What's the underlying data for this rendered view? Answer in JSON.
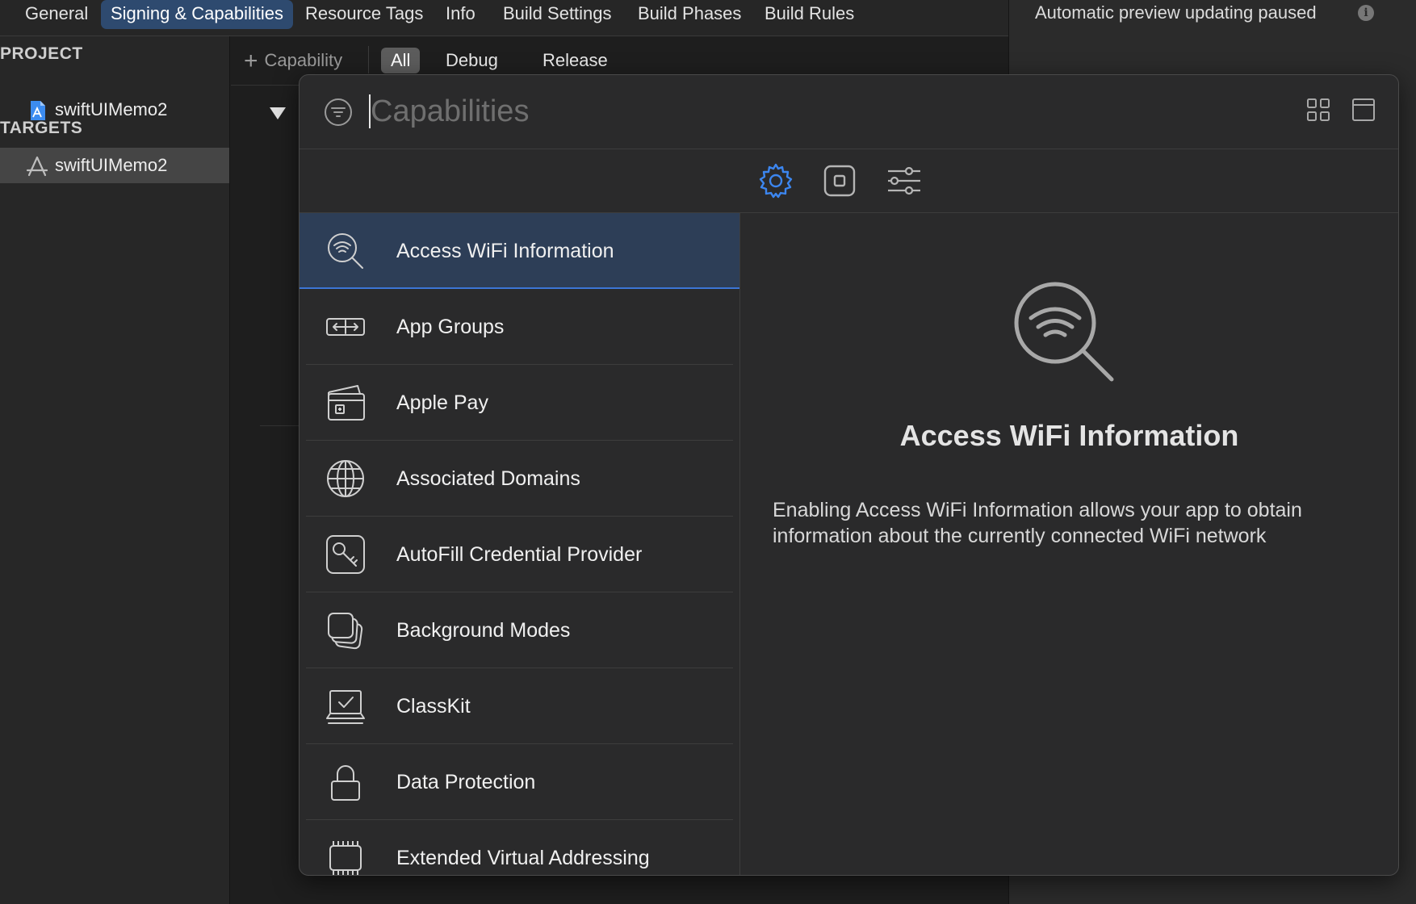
{
  "tabs": [
    {
      "label": "General",
      "active": false
    },
    {
      "label": "Signing & Capabilities",
      "active": true
    },
    {
      "label": "Resource Tags",
      "active": false
    },
    {
      "label": "Info",
      "active": false
    },
    {
      "label": "Build Settings",
      "active": false
    },
    {
      "label": "Build Phases",
      "active": false
    },
    {
      "label": "Build Rules",
      "active": false
    }
  ],
  "preview": {
    "message": "Automatic preview updating paused",
    "icon": "info-icon"
  },
  "sidebar": {
    "project_heading": "PROJECT",
    "project_item": {
      "label": "swiftUIMemo2",
      "icon": "project-file-icon"
    },
    "targets_heading": "TARGETS",
    "target_item": {
      "label": "swiftUIMemo2",
      "icon": "app-target-icon",
      "selected": true
    }
  },
  "editor": {
    "add_capability_label": "Capability",
    "configurations": [
      {
        "label": "All",
        "active": true
      },
      {
        "label": "Debug",
        "active": false
      },
      {
        "label": "Release",
        "active": false
      }
    ]
  },
  "popover": {
    "search_placeholder": "Capabilities",
    "search_value": "",
    "filter_buttons": [
      {
        "name": "gear-icon",
        "active": true
      },
      {
        "name": "square-icon",
        "active": false
      },
      {
        "name": "sliders-icon",
        "active": false
      }
    ],
    "capabilities": [
      {
        "label": "Access WiFi Information",
        "icon": "wifi-search-icon",
        "selected": true
      },
      {
        "label": "App Groups",
        "icon": "app-groups-icon",
        "selected": false
      },
      {
        "label": "Apple Pay",
        "icon": "apple-pay-icon",
        "selected": false
      },
      {
        "label": "Associated Domains",
        "icon": "globe-icon",
        "selected": false
      },
      {
        "label": "AutoFill Credential Provider",
        "icon": "key-icon",
        "selected": false
      },
      {
        "label": "Background Modes",
        "icon": "background-modes-icon",
        "selected": false
      },
      {
        "label": "ClassKit",
        "icon": "classkit-icon",
        "selected": false
      },
      {
        "label": "Data Protection",
        "icon": "lock-icon",
        "selected": false
      },
      {
        "label": "Extended Virtual Addressing",
        "icon": "chip-icon",
        "selected": false
      }
    ],
    "detail": {
      "title": "Access WiFi Information",
      "description": "Enabling Access WiFi Information allows your app to obtain information about the currently connected WiFi network"
    }
  },
  "colors": {
    "accent": "#3c76d6",
    "selected_row": "#2d3e57",
    "active_tab": "#2e4a6f",
    "popover_bg": "#2a2a2b"
  }
}
